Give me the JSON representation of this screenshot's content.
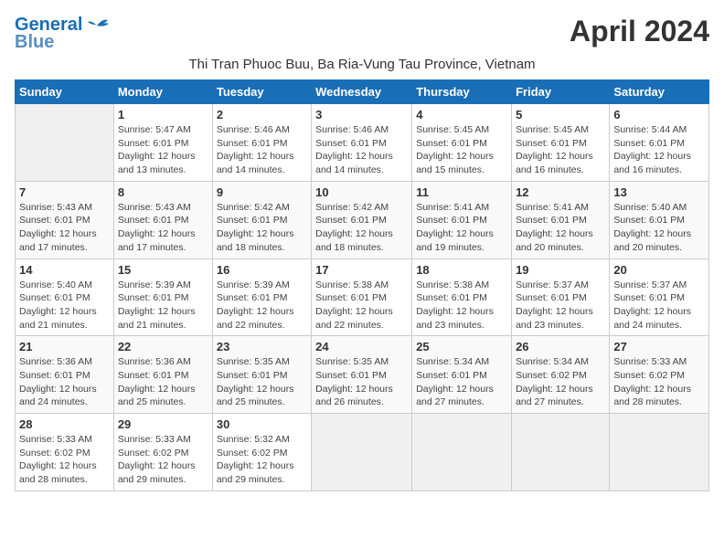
{
  "header": {
    "logo_line1": "General",
    "logo_line2": "Blue",
    "month_title": "April 2024",
    "subtitle": "Thi Tran Phuoc Buu, Ba Ria-Vung Tau Province, Vietnam"
  },
  "days_of_week": [
    "Sunday",
    "Monday",
    "Tuesday",
    "Wednesday",
    "Thursday",
    "Friday",
    "Saturday"
  ],
  "weeks": [
    [
      {
        "num": "",
        "info": ""
      },
      {
        "num": "1",
        "info": "Sunrise: 5:47 AM\nSunset: 6:01 PM\nDaylight: 12 hours\nand 13 minutes."
      },
      {
        "num": "2",
        "info": "Sunrise: 5:46 AM\nSunset: 6:01 PM\nDaylight: 12 hours\nand 14 minutes."
      },
      {
        "num": "3",
        "info": "Sunrise: 5:46 AM\nSunset: 6:01 PM\nDaylight: 12 hours\nand 14 minutes."
      },
      {
        "num": "4",
        "info": "Sunrise: 5:45 AM\nSunset: 6:01 PM\nDaylight: 12 hours\nand 15 minutes."
      },
      {
        "num": "5",
        "info": "Sunrise: 5:45 AM\nSunset: 6:01 PM\nDaylight: 12 hours\nand 16 minutes."
      },
      {
        "num": "6",
        "info": "Sunrise: 5:44 AM\nSunset: 6:01 PM\nDaylight: 12 hours\nand 16 minutes."
      }
    ],
    [
      {
        "num": "7",
        "info": "Sunrise: 5:43 AM\nSunset: 6:01 PM\nDaylight: 12 hours\nand 17 minutes."
      },
      {
        "num": "8",
        "info": "Sunrise: 5:43 AM\nSunset: 6:01 PM\nDaylight: 12 hours\nand 17 minutes."
      },
      {
        "num": "9",
        "info": "Sunrise: 5:42 AM\nSunset: 6:01 PM\nDaylight: 12 hours\nand 18 minutes."
      },
      {
        "num": "10",
        "info": "Sunrise: 5:42 AM\nSunset: 6:01 PM\nDaylight: 12 hours\nand 18 minutes."
      },
      {
        "num": "11",
        "info": "Sunrise: 5:41 AM\nSunset: 6:01 PM\nDaylight: 12 hours\nand 19 minutes."
      },
      {
        "num": "12",
        "info": "Sunrise: 5:41 AM\nSunset: 6:01 PM\nDaylight: 12 hours\nand 20 minutes."
      },
      {
        "num": "13",
        "info": "Sunrise: 5:40 AM\nSunset: 6:01 PM\nDaylight: 12 hours\nand 20 minutes."
      }
    ],
    [
      {
        "num": "14",
        "info": "Sunrise: 5:40 AM\nSunset: 6:01 PM\nDaylight: 12 hours\nand 21 minutes."
      },
      {
        "num": "15",
        "info": "Sunrise: 5:39 AM\nSunset: 6:01 PM\nDaylight: 12 hours\nand 21 minutes."
      },
      {
        "num": "16",
        "info": "Sunrise: 5:39 AM\nSunset: 6:01 PM\nDaylight: 12 hours\nand 22 minutes."
      },
      {
        "num": "17",
        "info": "Sunrise: 5:38 AM\nSunset: 6:01 PM\nDaylight: 12 hours\nand 22 minutes."
      },
      {
        "num": "18",
        "info": "Sunrise: 5:38 AM\nSunset: 6:01 PM\nDaylight: 12 hours\nand 23 minutes."
      },
      {
        "num": "19",
        "info": "Sunrise: 5:37 AM\nSunset: 6:01 PM\nDaylight: 12 hours\nand 23 minutes."
      },
      {
        "num": "20",
        "info": "Sunrise: 5:37 AM\nSunset: 6:01 PM\nDaylight: 12 hours\nand 24 minutes."
      }
    ],
    [
      {
        "num": "21",
        "info": "Sunrise: 5:36 AM\nSunset: 6:01 PM\nDaylight: 12 hours\nand 24 minutes."
      },
      {
        "num": "22",
        "info": "Sunrise: 5:36 AM\nSunset: 6:01 PM\nDaylight: 12 hours\nand 25 minutes."
      },
      {
        "num": "23",
        "info": "Sunrise: 5:35 AM\nSunset: 6:01 PM\nDaylight: 12 hours\nand 25 minutes."
      },
      {
        "num": "24",
        "info": "Sunrise: 5:35 AM\nSunset: 6:01 PM\nDaylight: 12 hours\nand 26 minutes."
      },
      {
        "num": "25",
        "info": "Sunrise: 5:34 AM\nSunset: 6:01 PM\nDaylight: 12 hours\nand 27 minutes."
      },
      {
        "num": "26",
        "info": "Sunrise: 5:34 AM\nSunset: 6:02 PM\nDaylight: 12 hours\nand 27 minutes."
      },
      {
        "num": "27",
        "info": "Sunrise: 5:33 AM\nSunset: 6:02 PM\nDaylight: 12 hours\nand 28 minutes."
      }
    ],
    [
      {
        "num": "28",
        "info": "Sunrise: 5:33 AM\nSunset: 6:02 PM\nDaylight: 12 hours\nand 28 minutes."
      },
      {
        "num": "29",
        "info": "Sunrise: 5:33 AM\nSunset: 6:02 PM\nDaylight: 12 hours\nand 29 minutes."
      },
      {
        "num": "30",
        "info": "Sunrise: 5:32 AM\nSunset: 6:02 PM\nDaylight: 12 hours\nand 29 minutes."
      },
      {
        "num": "",
        "info": ""
      },
      {
        "num": "",
        "info": ""
      },
      {
        "num": "",
        "info": ""
      },
      {
        "num": "",
        "info": ""
      }
    ]
  ]
}
